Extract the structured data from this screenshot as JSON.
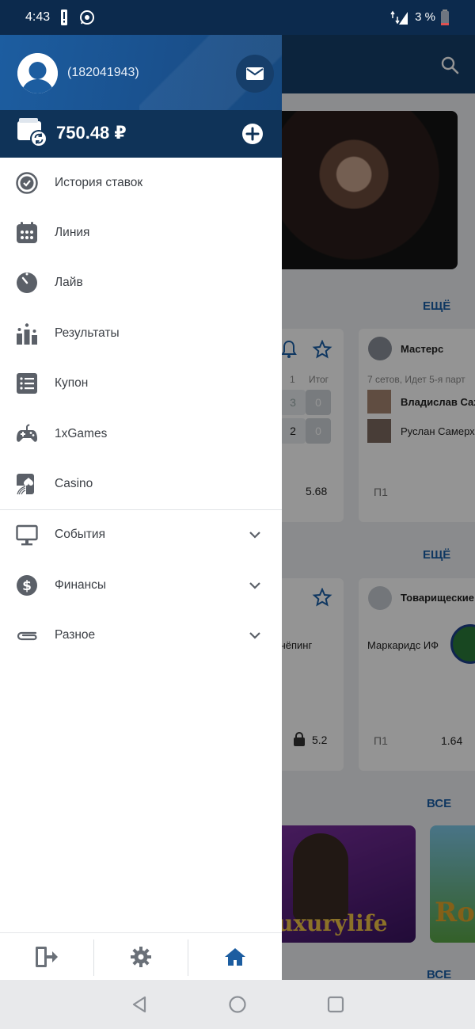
{
  "status_bar": {
    "time": "4:43",
    "network": "4G",
    "battery": "3 %"
  },
  "drawer": {
    "user_id": "(182041943)",
    "balance": "750.48 ₽",
    "menu": [
      {
        "label": "История ставок",
        "icon": "bet-history-icon"
      },
      {
        "label": "Линия",
        "icon": "calendar-icon"
      },
      {
        "label": "Лайв",
        "icon": "stopwatch-icon"
      },
      {
        "label": "Результаты",
        "icon": "results-icon"
      },
      {
        "label": "Купон",
        "icon": "coupon-list-icon"
      },
      {
        "label": "1xGames",
        "icon": "gamepad-icon"
      },
      {
        "label": "Casino",
        "icon": "casino-cards-icon"
      }
    ],
    "expandable": [
      {
        "label": "События",
        "icon": "monitor-icon"
      },
      {
        "label": "Финансы",
        "icon": "dollar-icon"
      },
      {
        "label": "Разное",
        "icon": "paperclip-icon"
      }
    ]
  },
  "background": {
    "more_labels": [
      "ЕЩЁ",
      "ЕЩЁ",
      "ВСЕ",
      "ВСЕ"
    ],
    "card1": {
      "col1": "1",
      "col2": "Итог",
      "s1": "3",
      "t1": "0",
      "s2": "2",
      "t2": "0",
      "odds": "5.68"
    },
    "card2": {
      "title": "Мастерс",
      "subtitle": "7 сетов, Идет 5-я парт",
      "player1": "Владислав Сах",
      "player2": "Руслан Самерх",
      "bet": "П1"
    },
    "card3": {
      "text": "чёпинг",
      "odds": "5.2"
    },
    "card4": {
      "title": "Товарищеские",
      "team": "Маркаридс ИФ",
      "bet": "П1",
      "odds": "1.64"
    },
    "game1": "uxurylife",
    "game2": "Ro"
  },
  "colors": {
    "header": "#1c5da0",
    "balance_bar": "#0f3358",
    "accent": "#1b5fa8",
    "menu_text": "#3b3f45"
  }
}
